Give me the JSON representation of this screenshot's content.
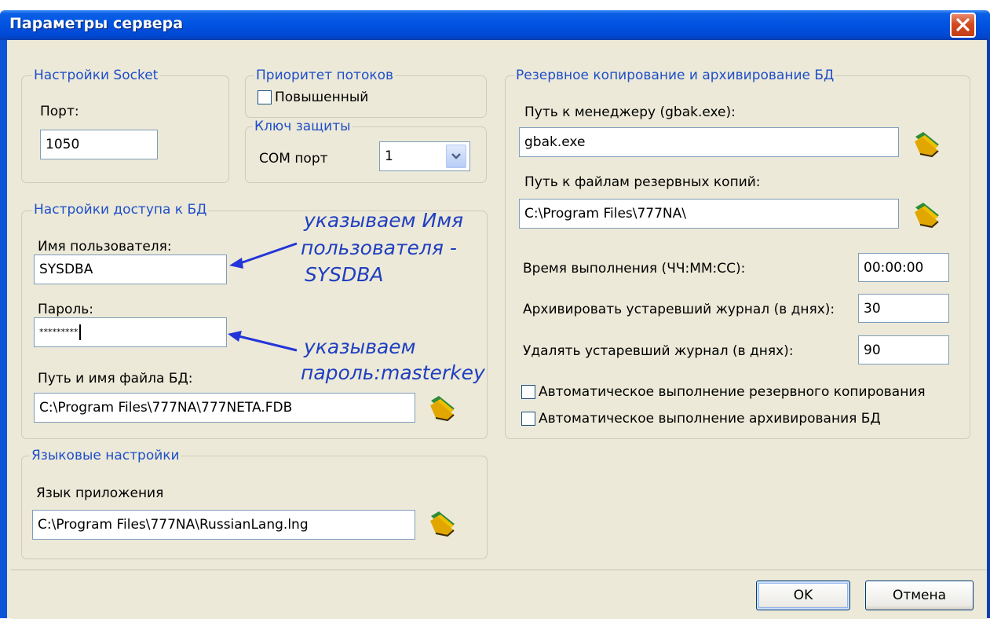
{
  "window": {
    "title": "Параметры сервера"
  },
  "socket": {
    "legend": "Настройки Socket",
    "port_label": "Порт:",
    "port_value": "1050"
  },
  "priority": {
    "legend": "Приоритет потоков",
    "elevated_label": "Повышенный",
    "elevated_checked": false
  },
  "key": {
    "legend": "Ключ защиты",
    "com_label": "COM порт",
    "com_value": "1"
  },
  "db_access": {
    "legend": "Настройки доступа к БД",
    "user_label": "Имя пользователя:",
    "user_value": "SYSDBA",
    "password_label": "Пароль:",
    "password_value": "*********",
    "db_path_label": "Путь и имя файла БД:",
    "db_path_value": "C:\\Program Files\\777NA\\777NETA.FDB"
  },
  "language": {
    "legend": "Языковые настройки",
    "app_lang_label": "Язык приложения",
    "app_lang_value": "C:\\Program Files\\777NA\\RussianLang.lng"
  },
  "backup": {
    "legend": "Резервное копирование и архивирование БД",
    "manager_label": "Путь к менеджеру (gbak.exe):",
    "manager_value": "gbak.exe",
    "backup_path_label": "Путь к файлам резервных копий:",
    "backup_path_value": "C:\\Program Files\\777NA\\",
    "time_label": "Время выполнения (ЧЧ:ММ:СС):",
    "time_value": "00:00:00",
    "archive_label": "Архивировать устаревший журнал (в днях):",
    "archive_value": "30",
    "delete_label": "Удалять устаревший журнал (в днях):",
    "delete_value": "90",
    "auto_backup_label": "Автоматическое выполнение резервного копирования",
    "auto_archive_label": "Автоматическое выполнение архивирования БД"
  },
  "annotations": {
    "user_note_line1": "указываем Имя",
    "user_note_line2": "пользователя -",
    "user_note_line3": "SYSDBA",
    "password_note_line1": "указываем",
    "password_note_line2": "пароль:masterkey"
  },
  "buttons": {
    "ok": "OK",
    "cancel": "Отмена"
  },
  "colors": {
    "titlebar": "#0052e0",
    "dialog_bg": "#ece9d8",
    "legend_text": "#1f4fc8",
    "annotation": "#1f3fc0"
  }
}
